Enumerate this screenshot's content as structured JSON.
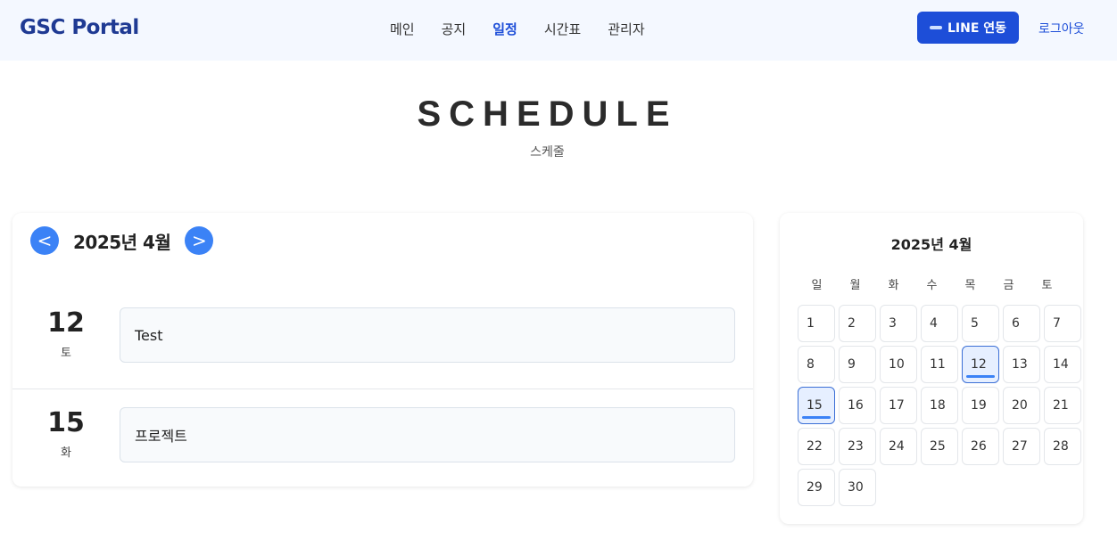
{
  "header": {
    "brand": "GSC Portal",
    "nav": [
      {
        "label": "메인",
        "active": false
      },
      {
        "label": "공지",
        "active": false
      },
      {
        "label": "일정",
        "active": true
      },
      {
        "label": "시간표",
        "active": false
      },
      {
        "label": "관리자",
        "active": false
      }
    ],
    "line_button_label": "LINE 연동",
    "line_icon": "line-logo-icon",
    "logout_label": "로그아웃"
  },
  "hero": {
    "title": "SCHEDULE",
    "subtitle": "스케줄"
  },
  "schedule": {
    "month_label": "2025년 4월",
    "prev_label": "<",
    "next_label": ">",
    "events": [
      {
        "day": "12",
        "weekday": "토",
        "title": "Test"
      },
      {
        "day": "15",
        "weekday": "화",
        "title": "프로젝트"
      }
    ]
  },
  "mini_calendar": {
    "title": "2025년 4월",
    "weekdays": [
      "일",
      "월",
      "화",
      "수",
      "목",
      "금",
      "토"
    ],
    "days": [
      "1",
      "2",
      "3",
      "4",
      "5",
      "6",
      "7",
      "8",
      "9",
      "10",
      "11",
      "12",
      "13",
      "14",
      "15",
      "16",
      "17",
      "18",
      "19",
      "20",
      "21",
      "22",
      "23",
      "24",
      "25",
      "26",
      "27",
      "28",
      "29",
      "30"
    ],
    "event_days": [
      "12",
      "15"
    ]
  },
  "colors": {
    "accent": "#1d4ed8",
    "circle_button": "#3b82f6",
    "navbar_bg": "#f4f8ff"
  }
}
